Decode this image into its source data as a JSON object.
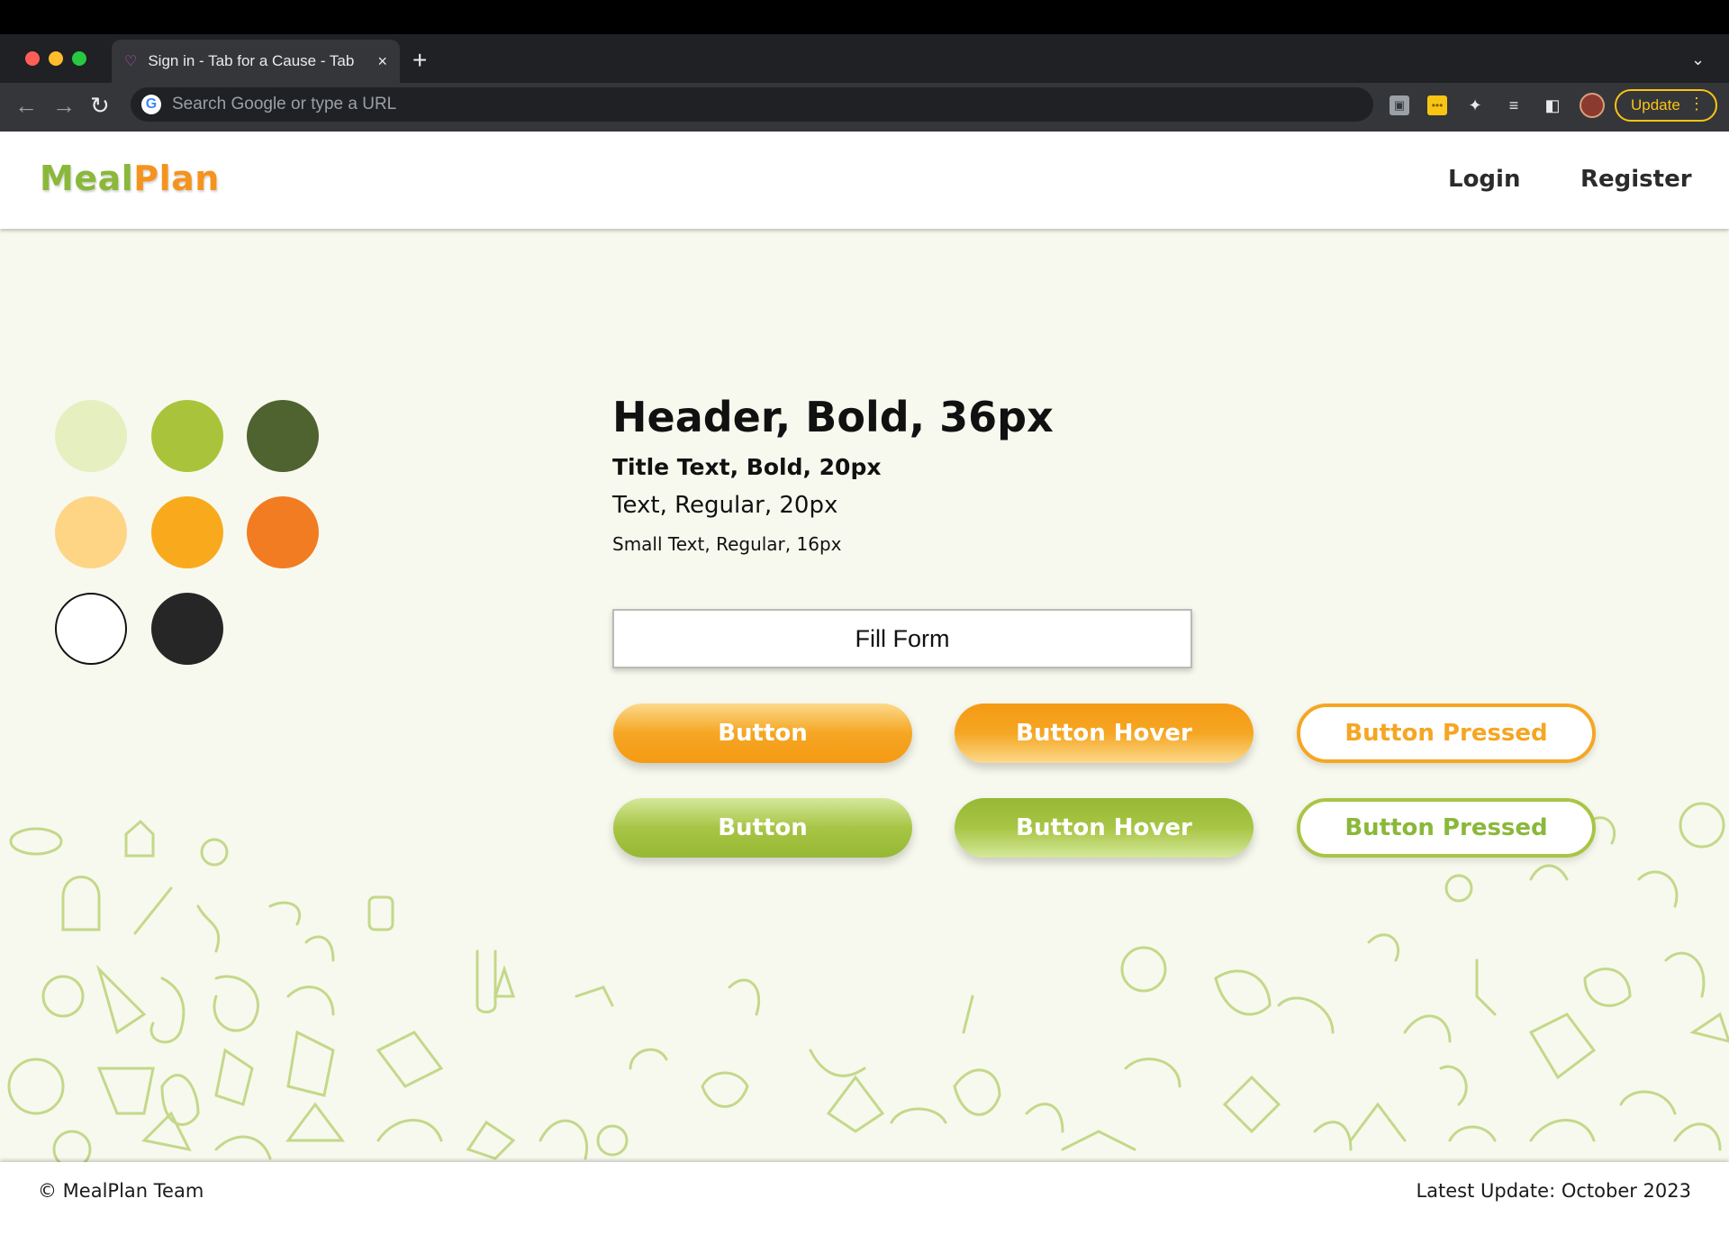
{
  "browser": {
    "tab_title": "Sign in - Tab for a Cause - Tab",
    "tab_close": "×",
    "new_tab": "+",
    "tab_menu": "⌄",
    "url_placeholder": "Search Google or type a URL",
    "google_glyph": "G",
    "update_label": "Update",
    "update_dots": "⋮",
    "icons": [
      "back-icon",
      "forward-icon",
      "reload-icon",
      "extension-icon",
      "puzzle-icon",
      "reading-list-icon",
      "side-panel-icon"
    ]
  },
  "header": {
    "logo_part1": "Meal",
    "logo_part2": "Plan",
    "nav": [
      {
        "label": "Login"
      },
      {
        "label": "Register"
      }
    ]
  },
  "palette": {
    "colors": [
      "#e6efbf",
      "#a9c43a",
      "#4f6330",
      "#fdd585",
      "#f9aa1c",
      "#f27c21",
      "#ffffff",
      "#262626"
    ]
  },
  "typography": {
    "header": "Header, Bold, 36px",
    "title": "Title Text, Bold, 20px",
    "text": "Text, Regular, 20px",
    "small": "Small Text, Regular, 16px"
  },
  "form": {
    "fill_form_value": "Fill Form"
  },
  "buttons": {
    "orange": {
      "normal": "Button",
      "hover": "Button Hover",
      "pressed": "Button Pressed"
    },
    "green": {
      "normal": "Button",
      "hover": "Button Hover",
      "pressed": "Button Pressed"
    }
  },
  "footer": {
    "left": "© MealPlan Team",
    "right": "Latest Update: October 2023"
  }
}
